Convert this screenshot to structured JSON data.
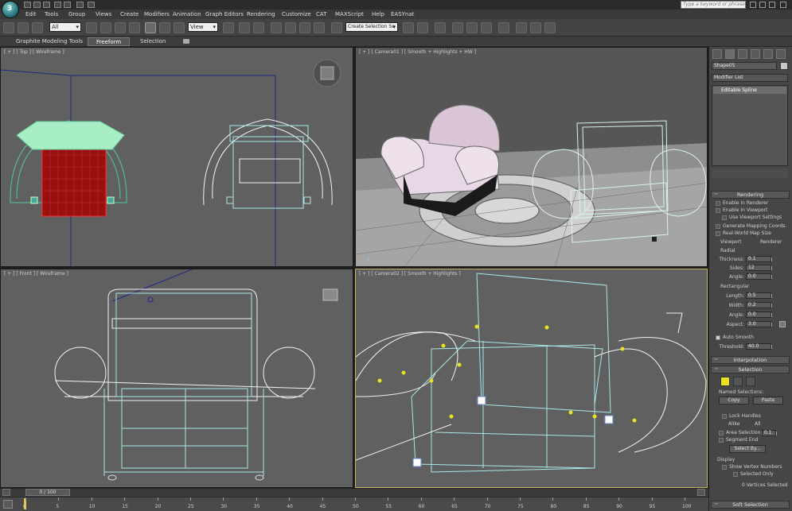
{
  "titlebar": {
    "search_placeholder": "Type a keyword or phrase"
  },
  "menu": [
    "Edit",
    "Tools",
    "Group",
    "Views",
    "Create",
    "Modifiers",
    "Animation",
    "Graph Editors",
    "Rendering",
    "Customize",
    "CAT",
    "MAXScript",
    "Help",
    "EASYnat"
  ],
  "toolbar": {
    "selection_filter": "All",
    "ref_coord": "View",
    "named_selection": "Create Selection Se"
  },
  "ribbon": {
    "tabs": [
      "Graphite Modeling Tools",
      "Freeform",
      "Selection"
    ],
    "active_tab": "Freeform"
  },
  "viewports": {
    "top": "[ + ] [ Top ] [ Wireframe ]",
    "camera01": "[ + ] [ Camera01 ] [ Smooth + Highlights + HW ]",
    "front": "[ + ] [ Front ] [ Wireframe ]",
    "camera02": "[ + ] [ Camera02 ] [ Smooth + Highlights ]"
  },
  "command_panel": {
    "object_name": "Shape05",
    "modifier_list": "Modifier List",
    "stack_item": "Editable Spline",
    "rendering": {
      "title": "Rendering",
      "enable_in_renderer": "Enable In Renderer",
      "enable_in_viewport": "Enable In Viewport",
      "use_viewport_settings": "Use Viewport Settings",
      "gen_mapping": "Generate Mapping Coords.",
      "real_world": "Real-World Map Size",
      "viewport": "Viewport",
      "renderer": "Renderer",
      "radial": "Radial",
      "thickness_label": "Thickness:",
      "thickness": "0.1",
      "sides_label": "Sides:",
      "sides": "12",
      "angle_label": "Angle:",
      "angle": "0.0",
      "rectangular": "Rectangular",
      "length_label": "Length:",
      "length": "0.5",
      "width_label": "Width:",
      "width": "0.2",
      "angle2_label": "Angle:",
      "angle2": "0.0",
      "aspect_label": "Aspect:",
      "aspect": "3.0",
      "auto_smooth": "Auto Smooth",
      "threshold_label": "Threshold:",
      "threshold": "40.0"
    },
    "interpolation": {
      "title": "Interpolation"
    },
    "selection": {
      "title": "Selection",
      "named_selections": "Named Selections:",
      "copy": "Copy",
      "paste": "Paste",
      "lock_handles": "Lock Handles",
      "alike": "Alike",
      "all": "All",
      "area_selection": "Area Selection:",
      "area_value": "0.1",
      "segment_end": "Segment End",
      "select_by": "Select By...",
      "display": "Display",
      "show_vertex_numbers": "Show Vertex Numbers",
      "selected_only": "Selected Only",
      "status": "0 Vertices Selected"
    },
    "soft_selection": {
      "title": "Soft Selection"
    }
  },
  "timeline": {
    "frame": "0 / 100",
    "ticks": [
      "0",
      "5",
      "10",
      "15",
      "20",
      "25",
      "30",
      "35",
      "40",
      "45",
      "50",
      "55",
      "60",
      "65",
      "70",
      "75",
      "80",
      "85",
      "90",
      "95",
      "100"
    ]
  },
  "colors": {
    "wire_cyan": "#a9e6e6",
    "wire_white": "#f2f2f2",
    "selected_red": "#b01818",
    "mint": "#9fe8b9",
    "vertex_yellow": "#e8e020",
    "active_border": "#c9b45d"
  }
}
